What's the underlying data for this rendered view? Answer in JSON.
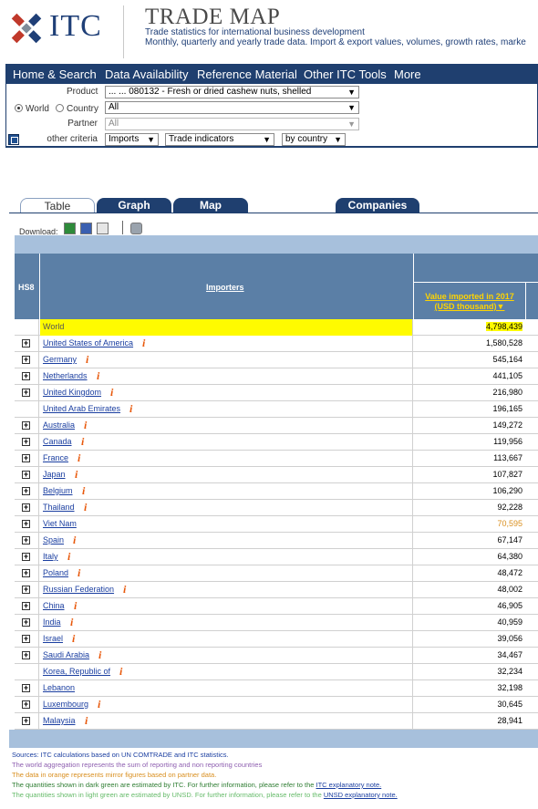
{
  "header": {
    "logo_text": "ITC",
    "title": "TRADE MAP",
    "subtitle1": "Trade statistics for international business development",
    "subtitle2": "Monthly, quarterly and yearly trade data. Import & export values, volumes, growth rates, marke"
  },
  "nav": [
    "Home & Search",
    "Data Availability",
    "Reference Material",
    "Other ITC Tools",
    "More"
  ],
  "filters": {
    "product_label": "Product",
    "product_value": "... ... 080132 - Fresh or dried cashew nuts, shelled",
    "world_label": "World",
    "country_label": "Country",
    "country_value": "All",
    "partner_label": "Partner",
    "partner_value": "All",
    "other_label": "other criteria",
    "flow": "Imports",
    "indicator": "Trade indicators",
    "by": "by country"
  },
  "tabs": [
    "Table",
    "Graph",
    "Map",
    "Companies"
  ],
  "download_label": "Download:",
  "table": {
    "hs8_header": "HS8",
    "importers_header": "Importers",
    "value_header_line1": "Value imported in 2017",
    "value_header_line2": "(USD thousand)▼",
    "rows": [
      {
        "name": "World",
        "value": "4,798,439",
        "plus": false,
        "info": false,
        "world": true
      },
      {
        "name": "United States of America",
        "value": "1,580,528",
        "plus": true,
        "info": true
      },
      {
        "name": "Germany",
        "value": "545,164",
        "plus": true,
        "info": true
      },
      {
        "name": "Netherlands",
        "value": "441,105",
        "plus": true,
        "info": true
      },
      {
        "name": "United Kingdom",
        "value": "216,980",
        "plus": true,
        "info": true
      },
      {
        "name": "United Arab Emirates",
        "value": "196,165",
        "plus": false,
        "info": true
      },
      {
        "name": "Australia",
        "value": "149,272",
        "plus": true,
        "info": true
      },
      {
        "name": "Canada",
        "value": "119,956",
        "plus": true,
        "info": true
      },
      {
        "name": "France",
        "value": "113,667",
        "plus": true,
        "info": true
      },
      {
        "name": "Japan",
        "value": "107,827",
        "plus": true,
        "info": true
      },
      {
        "name": "Belgium",
        "value": "106,290",
        "plus": true,
        "info": true
      },
      {
        "name": "Thailand",
        "value": "92,228",
        "plus": true,
        "info": true
      },
      {
        "name": "Viet Nam",
        "value": "70,595",
        "plus": true,
        "info": false,
        "orange": true
      },
      {
        "name": "Spain",
        "value": "67,147",
        "plus": true,
        "info": true
      },
      {
        "name": "Italy",
        "value": "64,380",
        "plus": true,
        "info": true
      },
      {
        "name": "Poland",
        "value": "48,472",
        "plus": true,
        "info": true
      },
      {
        "name": "Russian Federation",
        "value": "48,002",
        "plus": true,
        "info": true
      },
      {
        "name": "China",
        "value": "46,905",
        "plus": true,
        "info": true
      },
      {
        "name": "India",
        "value": "40,959",
        "plus": true,
        "info": true
      },
      {
        "name": "Israel",
        "value": "39,056",
        "plus": true,
        "info": true
      },
      {
        "name": "Saudi Arabia",
        "value": "34,467",
        "plus": true,
        "info": true
      },
      {
        "name": "Korea, Republic of",
        "value": "32,234",
        "plus": false,
        "info": true
      },
      {
        "name": "Lebanon",
        "value": "32,198",
        "plus": true,
        "info": false
      },
      {
        "name": "Luxembourg",
        "value": "30,645",
        "plus": true,
        "info": true
      },
      {
        "name": "Malaysia",
        "value": "28,941",
        "plus": true,
        "info": true
      }
    ]
  },
  "notes": {
    "n1": "Sources: ITC calculations based on UN COMTRADE and ITC statistics.",
    "n2": "The world aggregation represents the sum of reporting and non reporting countries",
    "n3": "The data in orange represents mirror figures based on partner data.",
    "n4": "The quantities shown in dark green are estimated by ITC. For further information, please refer to the ",
    "n4_link": "ITC explanatory note.",
    "n5": "The quantities shown in light green are estimated by UNSD. For further information, please refer to the ",
    "n5_link": "UNSD explanatory note."
  },
  "colors": {
    "nav_bg": "#1f3f6f",
    "header_blue": "#5b7fa6",
    "band_blue": "#a7c0dc",
    "highlight": "#fffb00",
    "link": "#1a3ea0",
    "info": "#e8590c"
  }
}
